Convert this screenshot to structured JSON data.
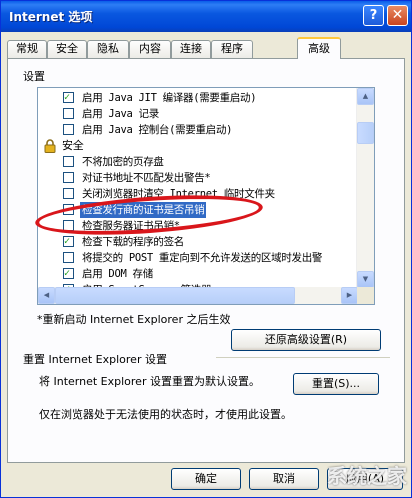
{
  "window": {
    "title": "Internet 选项"
  },
  "titlebar": {
    "help_glyph": "?",
    "close_glyph": "✕"
  },
  "tabs": [
    {
      "label": "常规"
    },
    {
      "label": "安全"
    },
    {
      "label": "隐私"
    },
    {
      "label": "内容"
    },
    {
      "label": "连接"
    },
    {
      "label": "程序"
    },
    {
      "label": "高级"
    }
  ],
  "settings_label": "设置",
  "list": [
    {
      "type": "check",
      "checked": true,
      "label": "启用 Java JIT 编译器(需要重启动)"
    },
    {
      "type": "check",
      "checked": false,
      "label": "启用 Java 记录"
    },
    {
      "type": "check",
      "checked": false,
      "label": "启用 Java 控制台(需要重启动)"
    },
    {
      "type": "section",
      "icon": "lock-icon",
      "label": "安全"
    },
    {
      "type": "check",
      "checked": false,
      "label": "不将加密的页存盘"
    },
    {
      "type": "check",
      "checked": false,
      "label": "对证书地址不匹配发出警告*"
    },
    {
      "type": "check",
      "checked": false,
      "label": "关闭浏览器时清空 Internet 临时文件夹"
    },
    {
      "type": "check",
      "checked": false,
      "label": "检查发行商的证书是否吊销",
      "selected": true
    },
    {
      "type": "check",
      "checked": false,
      "label": "检查服务器证书吊销*"
    },
    {
      "type": "check",
      "checked": true,
      "label": "检查下载的程序的签名"
    },
    {
      "type": "check",
      "checked": false,
      "label": "将提交的 POST 重定向到不允许发送的区域时发出警"
    },
    {
      "type": "check",
      "checked": true,
      "label": "启用 DOM 存储"
    },
    {
      "type": "check",
      "checked": true,
      "label": "启用 SmartScreen 筛选器"
    }
  ],
  "restart_note": "*重新启动 Internet Explorer 之后生效",
  "restore_button": "还原高级设置(R)",
  "reset_group_title": "重置 Internet Explorer 设置",
  "reset_desc": "将 Internet Explorer 设置重置为默认设置。",
  "reset_button": "重置(S)...",
  "reset_note": "仅在浏览器处于无法使用的状态时，才使用此设置。",
  "footer": {
    "ok": "确定",
    "cancel": "取消",
    "apply": "应用(A)"
  },
  "watermark": "系统之家",
  "colors": {
    "selection": "#316ac5",
    "annotation": "#d9161b",
    "titlebar": "#0a58e0"
  }
}
